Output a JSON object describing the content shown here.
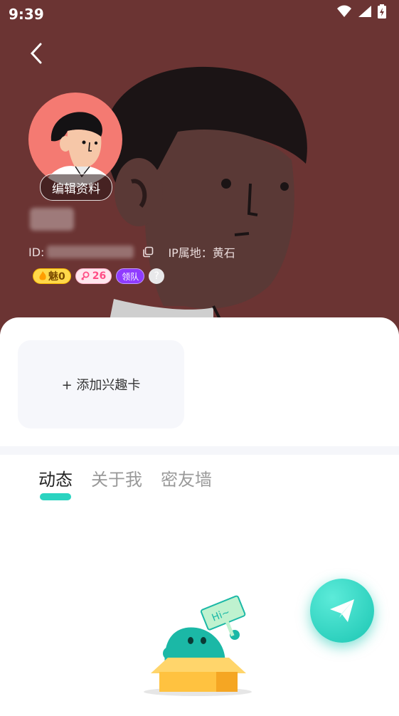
{
  "status_bar": {
    "time": "9:39"
  },
  "header": {
    "edit_profile_label": "编辑资料",
    "id_prefix": "ID:",
    "ip_location": "IP属地：黄石",
    "badges": {
      "charm": "魅0",
      "level": "26",
      "team": "领队",
      "help": "?"
    }
  },
  "interest_card": {
    "label": "+ 添加兴趣卡"
  },
  "tabs": [
    {
      "label": "动态",
      "active": true
    },
    {
      "label": "关于我",
      "active": false
    },
    {
      "label": "密友墙",
      "active": false
    }
  ],
  "empty_illustration": {
    "sign_text": "Hi~"
  },
  "colors": {
    "banner_bg": "#6b3433",
    "accent": "#2ad3c0",
    "fab": "#1bc6b3"
  }
}
